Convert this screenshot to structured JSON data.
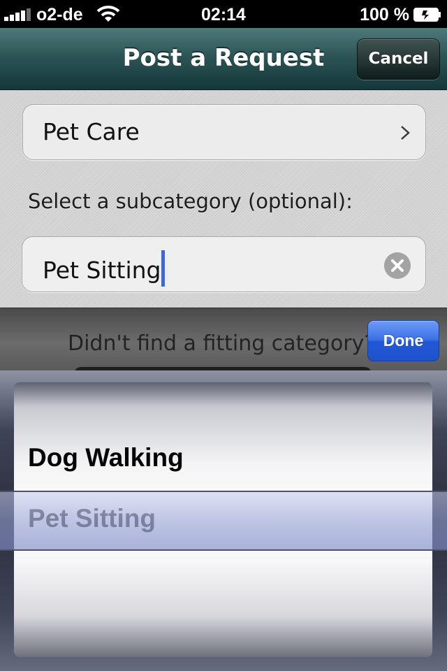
{
  "status_bar": {
    "carrier": "o2-de",
    "time": "02:14",
    "battery": "100 %"
  },
  "nav": {
    "title": "Post a Request",
    "cancel_label": "Cancel"
  },
  "form": {
    "category": "Pet Care",
    "subcategory_prompt": "Select a subcategory (optional):",
    "subcategory_value": "Pet Sitting"
  },
  "toolbar": {
    "hint": "Didn't find a fitting category?",
    "done_label": "Done"
  },
  "picker": {
    "options": [
      "Dog Walking",
      "Pet Sitting"
    ],
    "selected": "Pet Sitting"
  },
  "colors": {
    "nav_bar": "#2d5556",
    "done_button": "#3c6fe6",
    "text_cursor": "#3a67e4"
  }
}
